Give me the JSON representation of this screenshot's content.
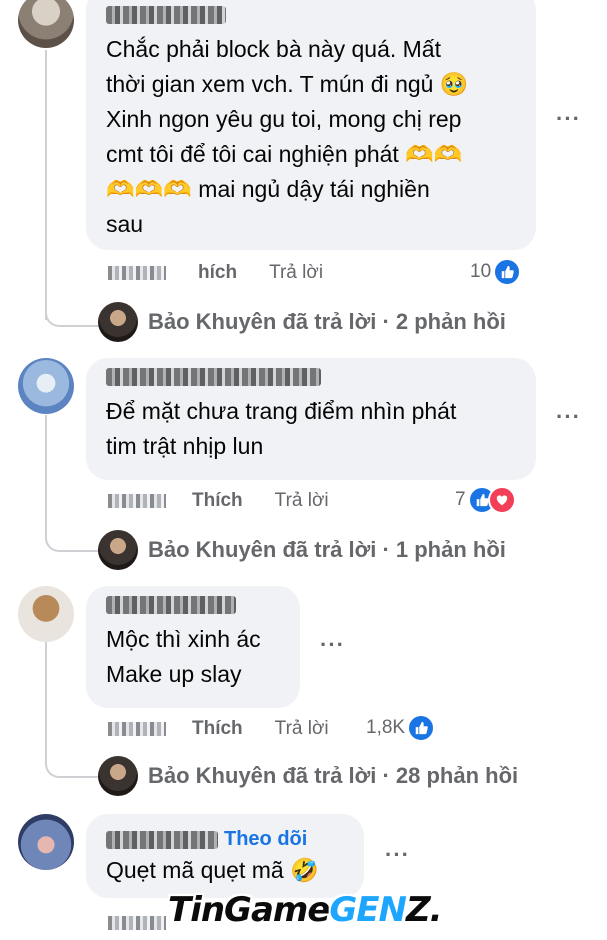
{
  "comments": [
    {
      "text": "Chắc phải block bà này quá. Mất\nthời gian xem vch. T mún đi ngủ 🥹\nXinh ngon yêu gu toi, mong chị rep\ncmt tôi để tôi cai nghiện phát 🫶🫶\n🫶🫶🫶 mai ngủ dậy tái nghiền\nsau",
      "like_label": "Thích",
      "like_label_partial": "hích",
      "reply_label": "Trả lời",
      "reaction_count": "10",
      "replies": "Bảo Khuyên đã trả lời · 2 phản hồi"
    },
    {
      "text": "Để mặt chưa trang điểm nhìn phát\ntim trật nhịp lun",
      "like_label": "Thích",
      "reply_label": "Trả lời",
      "reaction_count": "7",
      "replies": "Bảo Khuyên đã trả lời · 1 phản hồi"
    },
    {
      "text": "Mộc thì xinh ác\nMake up slay",
      "like_label": "Thích",
      "reply_label": "Trả lời",
      "reaction_count": "1,8K",
      "replies": "Bảo Khuyên đã trả lời · 28 phản hồi"
    },
    {
      "follow_label": "Theo dõi",
      "text": "Quẹt mã quẹt mã 🤣"
    }
  ],
  "more_glyph": "···",
  "watermark": {
    "part1": "TinGame",
    "part2": "GEN",
    "part3": "Z."
  },
  "colors": {
    "bubble": "#f0f2f5",
    "like_blue": "#1b74e4",
    "love_red": "#f33e58",
    "meta_gray": "#65676b"
  }
}
